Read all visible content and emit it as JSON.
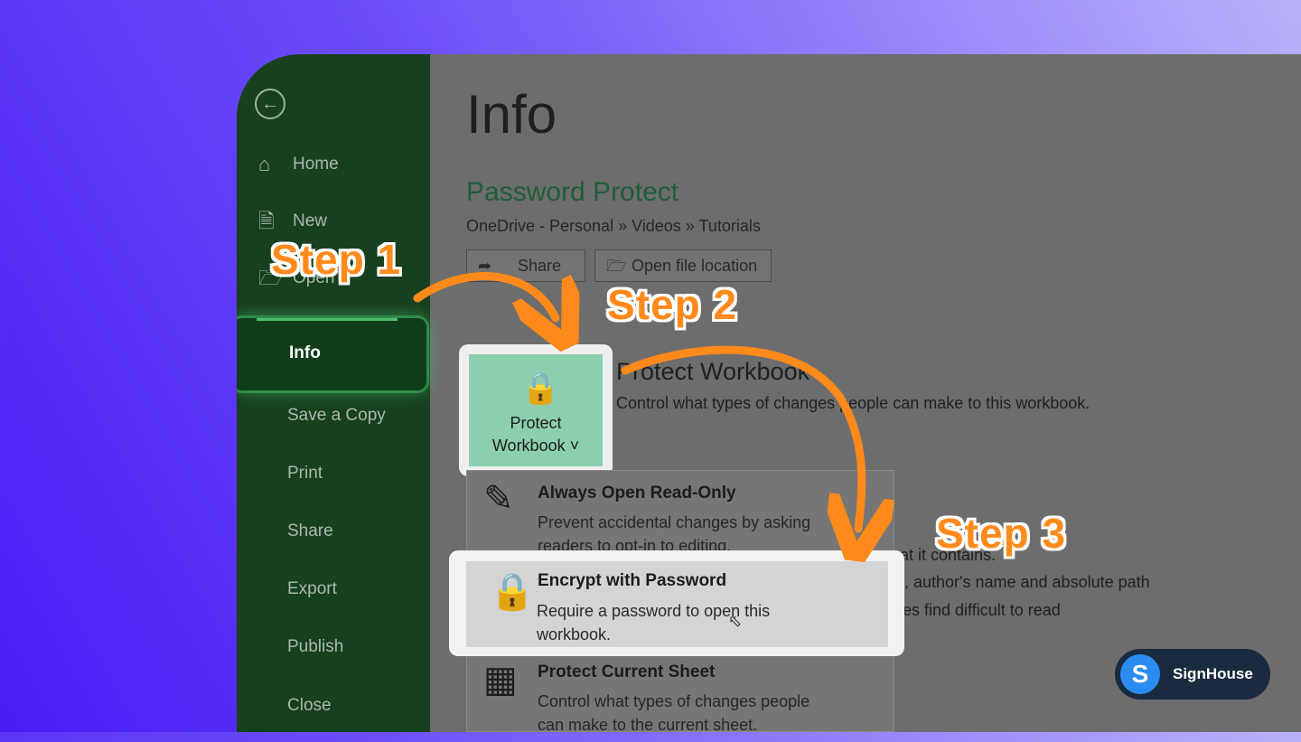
{
  "sidebar": {
    "back_icon": "arrow-left-circle-icon",
    "items": [
      {
        "label": "Home",
        "icon": "home-icon"
      },
      {
        "label": "New",
        "icon": "new-document-icon"
      },
      {
        "label": "Open",
        "icon": "folder-open-icon"
      },
      {
        "label": "Info"
      },
      {
        "label": "Save a Copy"
      },
      {
        "label": "Print"
      },
      {
        "label": "Share"
      },
      {
        "label": "Export"
      },
      {
        "label": "Publish"
      },
      {
        "label": "Close"
      }
    ]
  },
  "main": {
    "title": "Info",
    "document_title": "Password Protect",
    "breadcrumb": "OneDrive - Personal » Videos » Tutorials",
    "share_label": "Share",
    "open_location_label": "Open file location",
    "protect_tile_line1": "Protect",
    "protect_tile_line2": "Workbook ˅",
    "protect_title": "Protect Workbook",
    "protect_desc": "Control what types of changes people can make to this workbook.",
    "behind_text_1": "hat it contains.",
    "behind_text_2": "th, author's name and absolute path",
    "behind_text_3": "ities find difficult to read"
  },
  "menu": {
    "items": [
      {
        "heading": "Always Open Read-Only",
        "desc": "Prevent accidental changes by asking readers to opt-in to editing."
      },
      {
        "heading": "Encrypt with Password",
        "desc": "Require a password to open this workbook."
      },
      {
        "heading": "Protect Current Sheet",
        "desc": "Control what types of changes people can make to the current sheet."
      }
    ]
  },
  "annotations": {
    "step1": "Step 1",
    "step2": "Step 2",
    "step3": "Step 3",
    "color": "#ff8a1c"
  },
  "brand": {
    "logo_letter": "S",
    "name": "SignHouse"
  }
}
